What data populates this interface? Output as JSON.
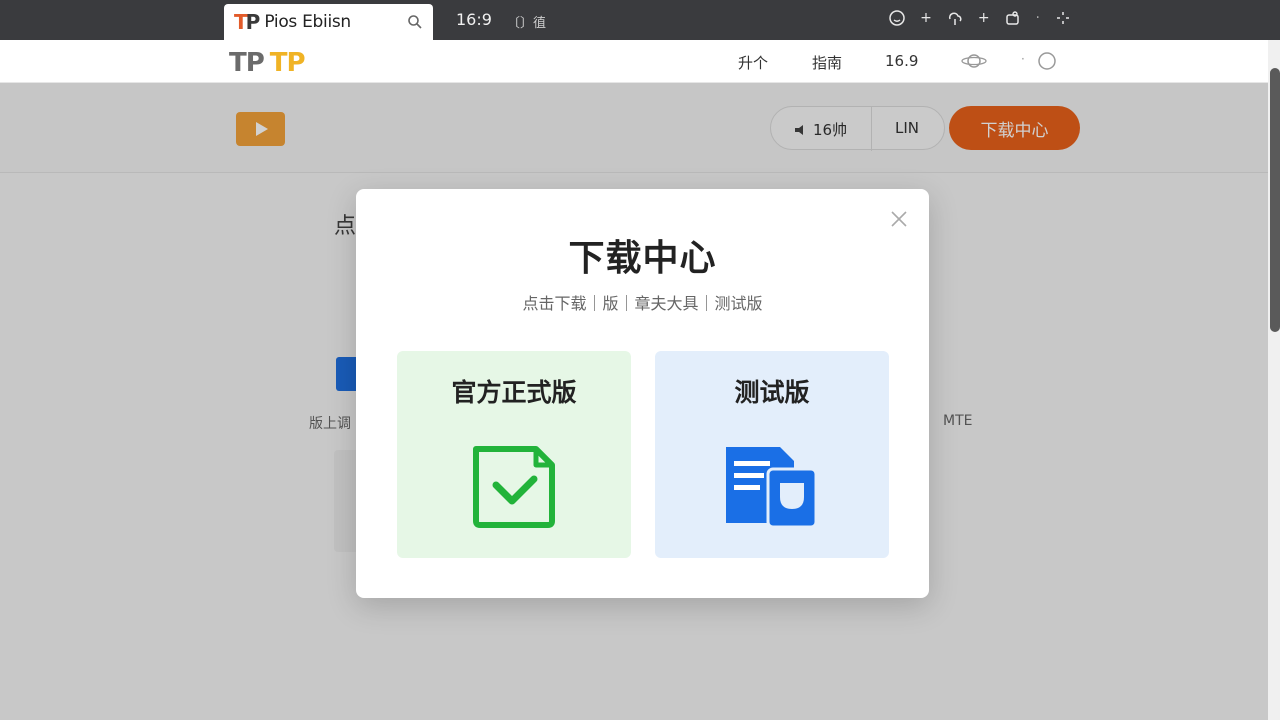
{
  "browser": {
    "tab_favicon_t": "T",
    "tab_favicon_p": "P",
    "tab_title": "Pios Ebiisn",
    "aspect_label": "16:9",
    "toolbar_extra": "〔〕徝"
  },
  "header": {
    "logo_part1": "TP",
    "logo_part2": "TP",
    "nav": [
      "升个",
      "指南",
      "16.9"
    ],
    "colors": {
      "logo_gray": "#6b6b6b",
      "logo_yellow": "#f0b325"
    }
  },
  "subheader": {
    "pill_a_label": "16帅",
    "pill_b_label": "LIN",
    "download_button": "下载中心",
    "colors": {
      "accent": "#e8611a",
      "play": "#f2a23a"
    }
  },
  "background": {
    "heading_fragment": "点",
    "left_text": "版上调",
    "right_text": "MTE"
  },
  "modal": {
    "title": "下载中心",
    "subtitle": "点击下载｜版｜章夫大具｜测试版",
    "options": [
      {
        "title": "官方正式版",
        "icon": "check-document-icon",
        "color": "#22b33a",
        "bg": "#e6f7e6"
      },
      {
        "title": "测试版",
        "icon": "beta-files-icon",
        "color": "#1a6fe6",
        "bg": "#e3eefb"
      }
    ]
  }
}
